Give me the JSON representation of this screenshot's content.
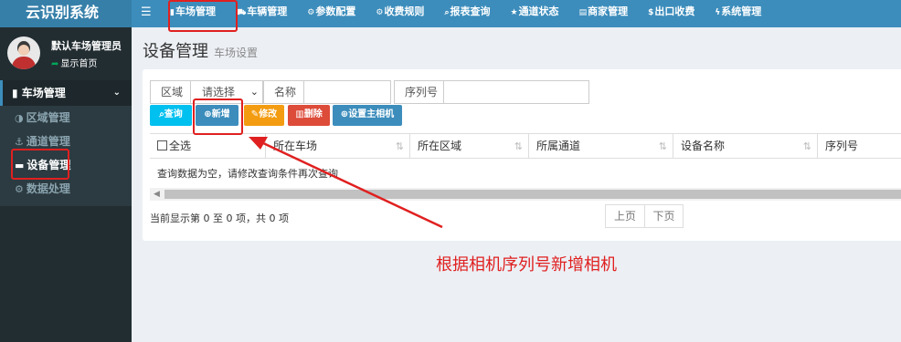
{
  "brand": "云识别系统",
  "nav": [
    {
      "icon": "▮",
      "label": "车场管理"
    },
    {
      "icon": "⛟",
      "label": "车辆管理"
    },
    {
      "icon": "⚙",
      "label": "参数配置"
    },
    {
      "icon": "⚙",
      "label": "收费规则"
    },
    {
      "icon": "⌕",
      "label": "报表查询"
    },
    {
      "icon": "★",
      "label": "通道状态"
    },
    {
      "icon": "▤",
      "label": "商家管理"
    },
    {
      "icon": "$",
      "label": "出口收费"
    },
    {
      "icon": "ϟ",
      "label": "系统管理"
    }
  ],
  "user": {
    "name": "默认车场管理员",
    "status": "显示首页"
  },
  "sidebar": {
    "section": "车场管理",
    "items": [
      {
        "icon": "◑",
        "label": "区域管理"
      },
      {
        "icon": "⚓",
        "label": "通道管理"
      },
      {
        "icon": "▬",
        "label": "设备管理"
      },
      {
        "icon": "⚙",
        "label": "数据处理"
      }
    ]
  },
  "page": {
    "title": "设备管理",
    "subtitle": "车场设置"
  },
  "filters": {
    "area_label": "区域",
    "area_value": "请选择",
    "name_label": "名称",
    "name_value": "",
    "serial_label": "序列号",
    "serial_value": ""
  },
  "toolbar": {
    "query": "查询",
    "add": "新增",
    "edit": "修改",
    "delete": "删除",
    "set_main_camera": "设置主相机"
  },
  "table": {
    "columns": [
      "全选",
      "所在车场",
      "所在区域",
      "所属通道",
      "设备名称",
      "序列号"
    ],
    "empty_message": "查询数据为空，请修改查询条件再次查询"
  },
  "pagination": {
    "info": "当前显示第 0 至 0 项，共 0 项",
    "prev": "上页",
    "next": "下页"
  },
  "annotation": {
    "text": "根据相机序列号新增相机",
    "color": "#e02020"
  },
  "colors": {
    "header": "#3c8dbc",
    "sidebar": "#222d32",
    "info": "#00c0ef",
    "primary": "#3c8dbc",
    "warning": "#f39c12",
    "danger": "#dd4b39"
  }
}
